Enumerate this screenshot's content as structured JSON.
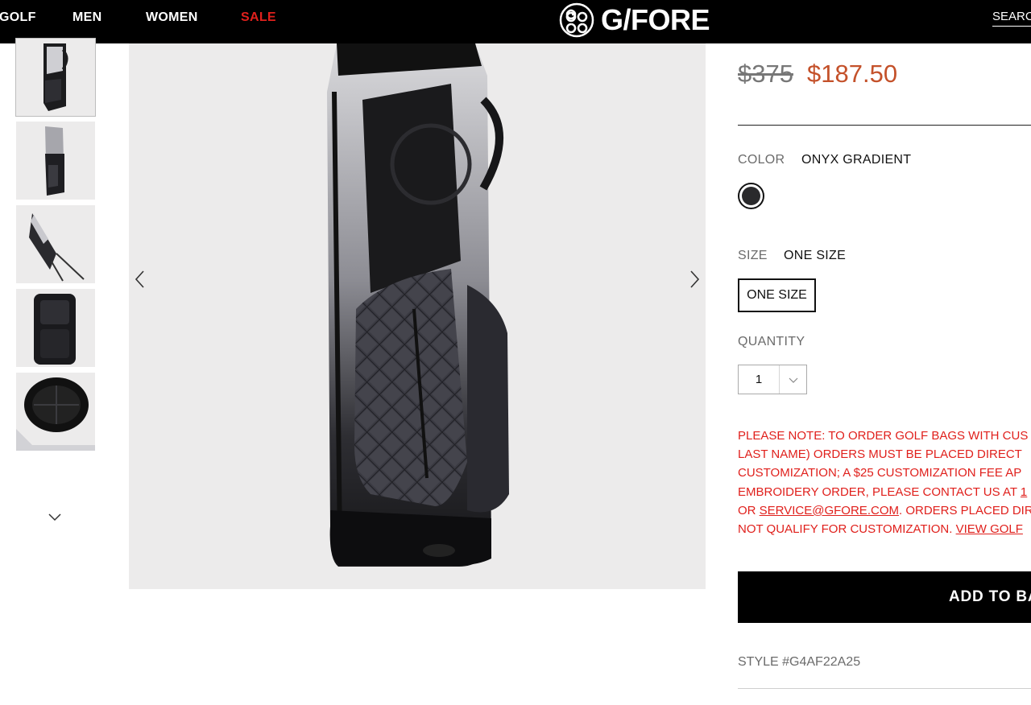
{
  "nav": {
    "items": [
      {
        "label": "GOLF"
      },
      {
        "label": "MEN"
      },
      {
        "label": "WOMEN"
      },
      {
        "label": "SALE"
      }
    ],
    "logo_text": "G/FORE",
    "search_label": "SEARC"
  },
  "product": {
    "price_original": "$375",
    "price_sale": "$187.50",
    "color_label": "COLOR",
    "color_value": "ONYX GRADIENT",
    "size_label": "SIZE",
    "size_value": "ONE SIZE",
    "size_option": "ONE SIZE",
    "quantity_label": "QUANTITY",
    "quantity_value": "1",
    "note": {
      "line1": "PLEASE NOTE: TO ORDER GOLF BAGS WITH CUS",
      "line2": "LAST NAME) ORDERS MUST BE PLACED DIRECT",
      "line3": "CUSTOMIZATION; A $25 CUSTOMIZATION FEE AP",
      "line4_pre": "EMBROIDERY ORDER, PLEASE CONTACT US AT ",
      "line4_link": "1",
      "line5_pre": "OR ",
      "line5_link": "SERVICE@GFORE.COM",
      "line5_post": ". ORDERS PLACED DIR",
      "line6_pre": "NOT QUALIFY FOR CUSTOMIZATION. ",
      "line6_link": "VIEW GOLF"
    },
    "add_to_bag": "ADD TO BA",
    "style_number": "STYLE #G4AF22A25"
  },
  "colors": {
    "sale_red": "#e0201c",
    "price_sale": "#c4512a",
    "swatch": "#2a2a2c"
  }
}
